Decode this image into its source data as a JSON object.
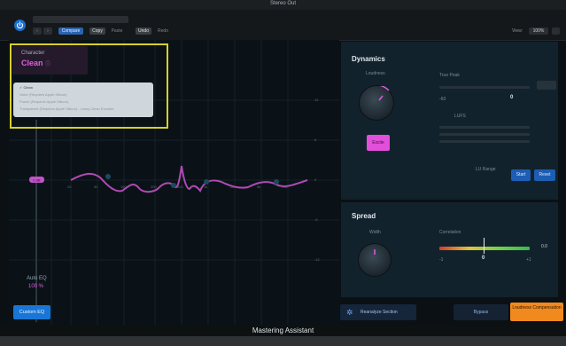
{
  "window": {
    "title": "Stereo Out"
  },
  "toolbar": {
    "compare": "Compare",
    "copy": "Copy",
    "paste": "Paste",
    "undo": "Undo",
    "redo": "Redo",
    "view_label": "View:",
    "view_value": "100%"
  },
  "character": {
    "label": "Character",
    "value": "Clean",
    "options": [
      "Clean",
      "Valve (Requires Apple Silicon)",
      "Punch (Requires Apple Silicon)",
      "Transparent (Requires Apple Silicon) - Lossy Clean Encoder"
    ]
  },
  "eq": {
    "autoeq_label": "Auto EQ",
    "autoeq_value": "100 %",
    "custom_eq": "Custom EQ",
    "freq_ticks": [
      "20",
      "50",
      "100",
      "200",
      "500",
      "1k",
      "2k",
      "5k",
      "10k"
    ],
    "db_ticks": [
      "12",
      "6",
      "0",
      "-6",
      "-12"
    ],
    "handle_label": "0 dB"
  },
  "dynamics": {
    "title": "Dynamics",
    "loudness_label": "Loudness",
    "excite": "Excite",
    "true_peak_label": "True Peak",
    "true_peak_value": "0",
    "true_peak_min": "-60",
    "lufs_label": "LUFS",
    "lu_range_label": "LU Range",
    "start": "Start",
    "reset": "Reset"
  },
  "spread": {
    "title": "Spread",
    "width_label": "Width",
    "correlation_label": "Correlation",
    "correlation_value": "0",
    "correlation_min": "-1",
    "correlation_max": "+1",
    "readout": "0.0"
  },
  "bottom": {
    "analyze": "Reanalyze Section",
    "bypass": "Bypass",
    "loudness_comp": "Loudness Compensation"
  },
  "footer": {
    "title": "Mastering Assistant"
  },
  "colors": {
    "accent": "#e05ce0",
    "blue": "#1877d6",
    "orange": "#f08a1e",
    "highlight": "#d8d02a"
  }
}
